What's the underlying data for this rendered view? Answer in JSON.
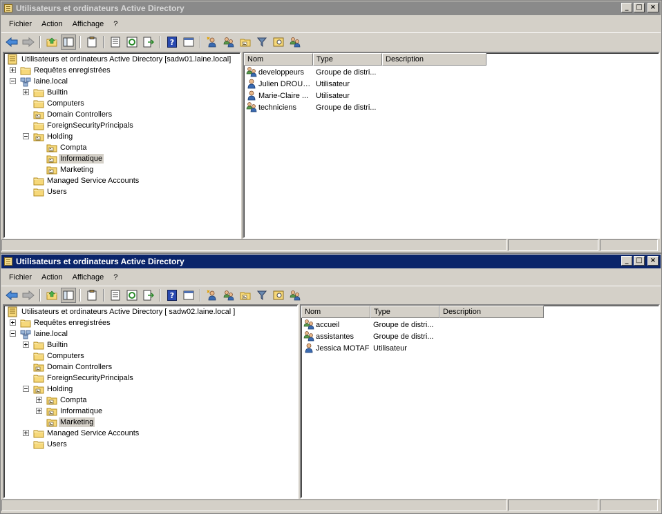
{
  "windows": [
    {
      "title": "Utilisateurs et ordinateurs Active Directory",
      "menu": [
        "Fichier",
        "Action",
        "Affichage",
        "?"
      ],
      "tree": {
        "root_label": "Utilisateurs et ordinateurs Active Directory [sadw01.laine.local]",
        "saved_queries": "Requêtes enregistrées",
        "domain": "laine.local",
        "builtin": "Builtin",
        "computers": "Computers",
        "domain_controllers": "Domain Controllers",
        "fsp": "ForeignSecurityPrincipals",
        "holding": "Holding",
        "compta": "Compta",
        "informatique": "Informatique",
        "marketing": "Marketing",
        "msa": "Managed Service Accounts",
        "users": "Users",
        "selected": "Informatique"
      },
      "list": {
        "columns": [
          "Nom",
          "Type",
          "Description"
        ],
        "rows": [
          {
            "name": "developpeurs",
            "type": "Groupe de distri...",
            "description": "",
            "icon": "group-icon"
          },
          {
            "name": "Julien DROUET",
            "type": "Utilisateur",
            "description": "",
            "icon": "user-icon"
          },
          {
            "name": "Marie-Claire ...",
            "type": "Utilisateur",
            "description": "",
            "icon": "user-icon"
          },
          {
            "name": "techniciens",
            "type": "Groupe de distri...",
            "description": "",
            "icon": "group-icon"
          }
        ]
      }
    },
    {
      "title": "Utilisateurs et ordinateurs Active Directory",
      "menu": [
        "Fichier",
        "Action",
        "Affichage",
        "?"
      ],
      "tree": {
        "root_label": "Utilisateurs et ordinateurs Active Directory [ sadw02.laine.local ]",
        "saved_queries": "Requêtes enregistrées",
        "domain": "laine.local",
        "builtin": "Builtin",
        "computers": "Computers",
        "domain_controllers": "Domain Controllers",
        "fsp": "ForeignSecurityPrincipals",
        "holding": "Holding",
        "compta": "Compta",
        "informatique": "Informatique",
        "marketing": "Marketing",
        "msa": "Managed Service Accounts",
        "users": "Users",
        "selected": "Marketing"
      },
      "list": {
        "columns": [
          "Nom",
          "Type",
          "Description"
        ],
        "rows": [
          {
            "name": "accueil",
            "type": "Groupe de distri...",
            "description": "",
            "icon": "group-icon"
          },
          {
            "name": "assistantes",
            "type": "Groupe de distri...",
            "description": "",
            "icon": "group-icon"
          },
          {
            "name": "Jessica MOTAF",
            "type": "Utilisateur",
            "description": "",
            "icon": "user-icon"
          }
        ]
      }
    }
  ],
  "colors": {
    "active_title": "#0a246a",
    "inactive_title": "#8a8a8a",
    "face": "#d4d0c8",
    "selection": "#d4d0c8"
  }
}
